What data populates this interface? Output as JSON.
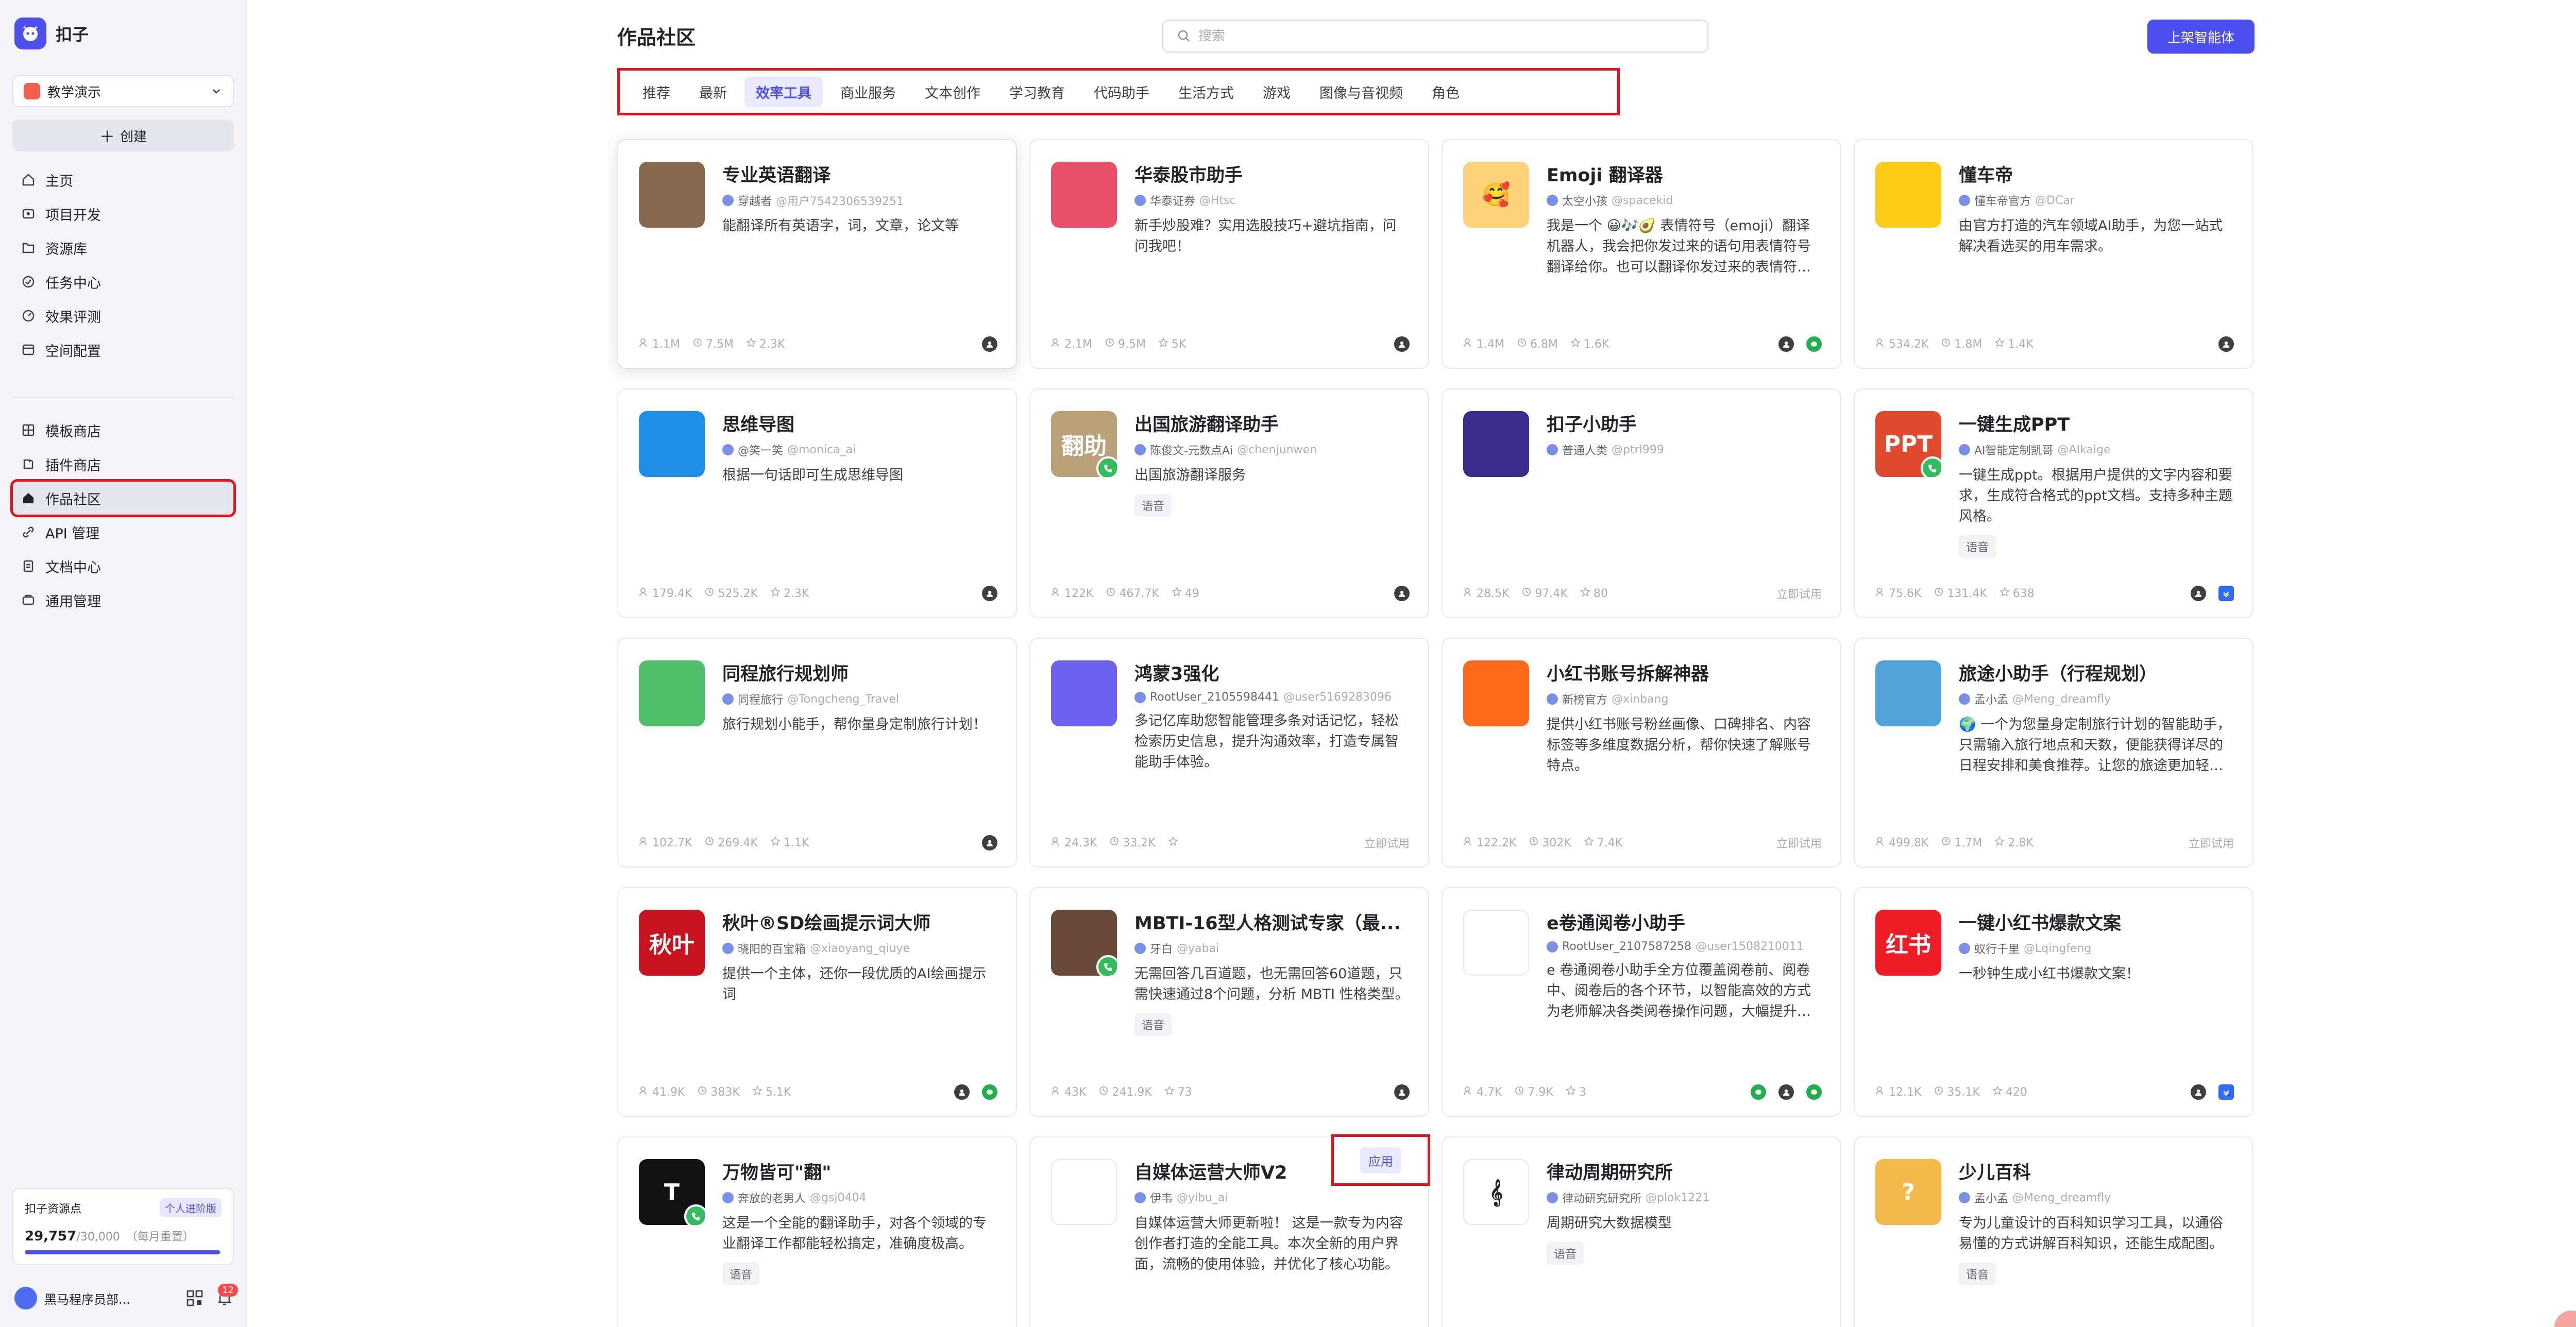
{
  "app": {
    "name": "扣子"
  },
  "sidebar": {
    "workspace": "教学演示",
    "create_label": "创建",
    "nav_group1": [
      {
        "label": "主页",
        "icon": "home-icon"
      },
      {
        "label": "项目开发",
        "icon": "project-icon"
      },
      {
        "label": "资源库",
        "icon": "library-icon"
      },
      {
        "label": "任务中心",
        "icon": "task-icon"
      },
      {
        "label": "效果评测",
        "icon": "eval-icon"
      },
      {
        "label": "空间配置",
        "icon": "space-config-icon"
      }
    ],
    "nav_group2": [
      {
        "label": "模板商店",
        "icon": "template-icon"
      },
      {
        "label": "插件商店",
        "icon": "plugin-icon"
      },
      {
        "label": "作品社区",
        "icon": "community-icon",
        "active": true
      },
      {
        "label": "API 管理",
        "icon": "api-icon"
      },
      {
        "label": "文档中心",
        "icon": "doc-icon"
      },
      {
        "label": "通用管理",
        "icon": "manage-icon"
      }
    ],
    "quota": {
      "title": "扣子资源点",
      "badge": "个人进阶版",
      "value": "29,757",
      "total": "/30,000",
      "note": "（每月重置）",
      "fraction": 0.992
    },
    "user": {
      "name": "黑马程序员部...",
      "notifications": "12"
    }
  },
  "header": {
    "title": "作品社区",
    "search_placeholder": "搜索",
    "publish_label": "上架智能体"
  },
  "tabs": [
    "推荐",
    "最新",
    "效率工具",
    "商业服务",
    "文本创作",
    "学习教育",
    "代码助手",
    "生活方式",
    "游戏",
    "图像与音视频",
    "角色"
  ],
  "active_tab": "效率工具",
  "cards": [
    {
      "title": "专业英语翻译",
      "author": "穿越者",
      "handle": "@用户7542306539251",
      "desc": "能翻译所有英语字，词，文章，论文等",
      "tag": "",
      "users": "1.1M",
      "runs": "7.5M",
      "stars": "2.3K",
      "trial": "",
      "channels": [
        "person"
      ],
      "icon_text": "",
      "icon_color": "#8a6a4e",
      "badge": false
    },
    {
      "title": "华泰股市助手",
      "author": "华泰证券",
      "handle": "@Htsc",
      "desc": "新手炒股难？实用选股技巧+避坑指南，问问我吧！",
      "tag": "",
      "users": "2.1M",
      "runs": "9.5M",
      "stars": "5K",
      "trial": "",
      "channels": [
        "person"
      ],
      "icon_text": "",
      "icon_color": "#e8506a",
      "badge": false
    },
    {
      "title": "Emoji 翻译器",
      "author": "太空小孩",
      "handle": "@spacekid",
      "desc": "我是一个 😀🎶🥑 表情符号（emoji）翻译机器人，我会把你发过来的语句用表情符号翻译给你。也可以翻译你发过来的表情符号。",
      "tag": "",
      "users": "1.4M",
      "runs": "6.8M",
      "stars": "1.6K",
      "trial": "",
      "channels": [
        "person",
        "wechat"
      ],
      "icon_text": "🥰",
      "icon_color": "#ffd37a",
      "badge": false
    },
    {
      "title": "懂车帝",
      "author": "懂车帝官方",
      "handle": "@DCar",
      "desc": "由官方打造的汽车领域AI助手，为您一站式解决看选买的用车需求。",
      "tag": "",
      "users": "534.2K",
      "runs": "1.8M",
      "stars": "1.4K",
      "trial": "",
      "channels": [
        "person"
      ],
      "icon_text": "",
      "icon_color": "#ffcc17",
      "badge": false
    },
    {
      "title": "思维导图",
      "author": "@笑一笑",
      "handle": "@monica_ai",
      "desc": "根据一句话即可生成思维导图",
      "tag": "",
      "users": "179.4K",
      "runs": "525.2K",
      "stars": "2.3K",
      "trial": "",
      "channels": [
        "person"
      ],
      "icon_text": "",
      "icon_color": "#1f8ee6",
      "badge": false
    },
    {
      "title": "出国旅游翻译助手",
      "author": "陈俊文-元数点Ai",
      "handle": "@chenjunwen",
      "desc": "出国旅游翻译服务",
      "tag": "语音",
      "users": "122K",
      "runs": "467.7K",
      "stars": "49",
      "trial": "",
      "channels": [
        "person"
      ],
      "icon_text": "翻助",
      "icon_color": "#b9a27a",
      "badge": true
    },
    {
      "title": "扣子小助手",
      "author": "普通人类",
      "handle": "@ptrl999",
      "desc": "",
      "tag": "",
      "users": "28.5K",
      "runs": "97.4K",
      "stars": "80",
      "trial": "立即试用",
      "channels": [],
      "icon_text": "",
      "icon_color": "#3a2b8c",
      "badge": false
    },
    {
      "title": "一键生成PPT",
      "author": "AI智能定制凯哥",
      "handle": "@AIkaige",
      "desc": "一键生成ppt。根据用户提供的文字内容和要求，生成符合格式的ppt文档。支持多种主题风格。",
      "tag": "语音",
      "users": "75.6K",
      "runs": "131.4K",
      "stars": "638",
      "trial": "",
      "channels": [
        "person",
        "feishu"
      ],
      "icon_text": "PPT",
      "icon_color": "#e04a2f",
      "badge": true
    },
    {
      "title": "同程旅行规划师",
      "author": "同程旅行",
      "handle": "@Tongcheng_Travel",
      "desc": "旅行规划小能手，帮你量身定制旅行计划！",
      "tag": "",
      "users": "102.7K",
      "runs": "269.4K",
      "stars": "1.1K",
      "trial": "",
      "channels": [
        "person"
      ],
      "icon_text": "",
      "icon_color": "#4fc06a",
      "badge": false
    },
    {
      "title": "鸿蒙3强化",
      "author": "RootUser_2105598441",
      "handle": "@user5169283096",
      "desc": "多记亿库助您智能管理多条对话记忆，轻松检索历史信息，提升沟通效率，打造专属智能助手体验。",
      "tag": "",
      "users": "24.3K",
      "runs": "33.2K",
      "stars": "",
      "trial": "立即试用",
      "channels": [],
      "icon_text": "",
      "icon_color": "#6b63f0",
      "badge": false
    },
    {
      "title": "小红书账号拆解神器",
      "author": "新榜官方",
      "handle": "@xinbang",
      "desc": "提供小红书账号粉丝画像、口碑排名、内容标签等多维度数据分析，帮你快速了解账号特点。",
      "tag": "",
      "users": "122.2K",
      "runs": "302K",
      "stars": "7.4K",
      "trial": "立即试用",
      "channels": [],
      "icon_text": "",
      "icon_color": "#ff6a1a",
      "badge": false
    },
    {
      "title": "旅途小助手（行程规划）",
      "author": "孟小孟",
      "handle": "@Meng_dreamfly",
      "desc": "🌍 一个为您量身定制旅行计划的智能助手，只需输入旅行地点和天数，便能获得详尽的日程安排和美食推荐。让您的旅途更加轻松愉快。",
      "tag": "",
      "users": "499.8K",
      "runs": "1.7M",
      "stars": "2.8K",
      "trial": "立即试用",
      "channels": [],
      "icon_text": "",
      "icon_color": "#4fa3d8",
      "badge": false
    },
    {
      "title": "秋叶®SD绘画提示词大师",
      "author": "晓阳的百宝箱",
      "handle": "@xiaoyang_qiuye",
      "desc": "提供一个主体，还你一段优质的AI绘画提示词",
      "tag": "",
      "users": "41.9K",
      "runs": "383K",
      "stars": "5.1K",
      "trial": "",
      "channels": [
        "person",
        "wechat"
      ],
      "icon_text": "秋叶",
      "icon_color": "#c8141e",
      "badge": false
    },
    {
      "title": "MBTI-16型人格测试专家（最...",
      "author": "牙白",
      "handle": "@yabai",
      "desc": "无需回答几百道题，也无需回答60道题，只需快速通过8个问题，分析 MBTI 性格类型。",
      "tag": "语音",
      "users": "43K",
      "runs": "241.9K",
      "stars": "73",
      "trial": "",
      "channels": [
        "person"
      ],
      "icon_text": "",
      "icon_color": "#6a4b3a",
      "badge": true
    },
    {
      "title": "e卷通阅卷小助手",
      "author": "RootUser_2107587258",
      "handle": "@user1508210011",
      "desc": "e 卷通阅卷小助手全方位覆盖阅卷前、阅卷中、阅卷后的各个环节，以智能高效的方式为老师解决各类阅卷操作问题，大幅提升效率。",
      "tag": "",
      "users": "4.7K",
      "runs": "7.9K",
      "stars": "3",
      "trial": "",
      "channels": [
        "wechat",
        "person",
        "wechat"
      ],
      "icon_text": "",
      "icon_color": "#ffffff",
      "badge": false
    },
    {
      "title": "一键小红书爆款文案",
      "author": "蚁行千里",
      "handle": "@Lqingfeng",
      "desc": "一秒钟生成小红书爆款文案！",
      "tag": "",
      "users": "12.1K",
      "runs": "35.1K",
      "stars": "420",
      "trial": "",
      "channels": [
        "person",
        "feishu"
      ],
      "icon_text": "红书",
      "icon_color": "#ee1c25",
      "badge": false
    },
    {
      "title": "万物皆可\"翻\"",
      "author": "奔放的老男人",
      "handle": "@gsj0404",
      "desc": "这是一个全能的翻译助手，对各个领域的专业翻译工作都能轻松搞定，准确度极高。",
      "tag": "语音",
      "users": "",
      "runs": "",
      "stars": "",
      "trial": "",
      "channels": [],
      "icon_text": "T",
      "icon_color": "#111111",
      "badge": true
    },
    {
      "title": "自媒体运营大师V2",
      "author": "伊韦",
      "handle": "@yibu_ai",
      "desc": "自媒体运营大师更新啦！ 这是一款专为内容创作者打造的全能工具。本次全新的用户界面，流畅的使用体验，并优化了核心功能。",
      "tag": "",
      "users": "",
      "runs": "",
      "stars": "",
      "trial": "",
      "channels": [],
      "icon_text": "",
      "icon_color": "#ffffff",
      "badge": false
    },
    {
      "title": "律动周期研究所",
      "author": "律动研究研究所",
      "handle": "@plok1221",
      "desc": "周期研究大数据模型",
      "tag": "语音",
      "users": "",
      "runs": "",
      "stars": "",
      "trial": "",
      "channels": [],
      "icon_text": "𝄞",
      "icon_color": "#ffffff",
      "badge": false
    },
    {
      "title": "少儿百科",
      "author": "孟小孟",
      "handle": "@Meng_dreamfly",
      "desc": "专为儿童设计的百科知识学习工具，以通俗易懂的方式讲解百科知识，还能生成配图。",
      "tag": "语音",
      "users": "",
      "runs": "",
      "stars": "",
      "trial": "",
      "channels": [],
      "icon_text": "?",
      "icon_color": "#f5b94a",
      "badge": false
    }
  ],
  "app_chip_label": "应用"
}
